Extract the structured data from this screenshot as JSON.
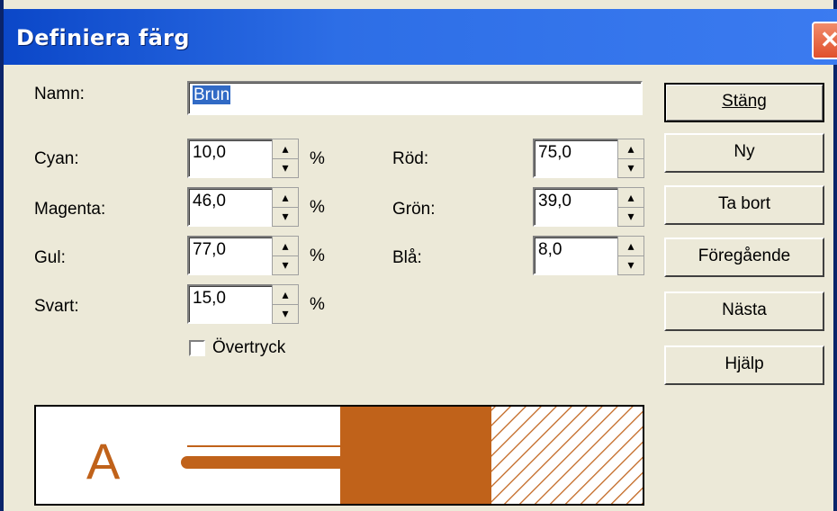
{
  "window": {
    "title": "Definiera färg",
    "close_label": "✕"
  },
  "name": {
    "label": "Namn:",
    "value": "Brun"
  },
  "cmyk": [
    {
      "label": "Cyan:",
      "value": "10,0",
      "unit": "%"
    },
    {
      "label": "Magenta:",
      "value": "46,0",
      "unit": "%"
    },
    {
      "label": "Gul:",
      "value": "77,0",
      "unit": "%"
    },
    {
      "label": "Svart:",
      "value": "15,0",
      "unit": "%"
    }
  ],
  "rgb": [
    {
      "label": "Röd:",
      "value": "75,0"
    },
    {
      "label": "Grön:",
      "value": "39,0"
    },
    {
      "label": "Blå:",
      "value": "8,0"
    }
  ],
  "overprint": {
    "label": "Övertryck",
    "checked": false
  },
  "buttons": {
    "close": "Stäng",
    "new": "Ny",
    "delete": "Ta bort",
    "previous": "Föregående",
    "next": "Nästa",
    "help": "Hjälp"
  },
  "preview": {
    "sample_letter": "A",
    "color": "#c0621a"
  },
  "colors": {
    "title_bar": "#2d6ee6",
    "dialog_bg": "#ece9d8",
    "selection": "#316ac5"
  }
}
